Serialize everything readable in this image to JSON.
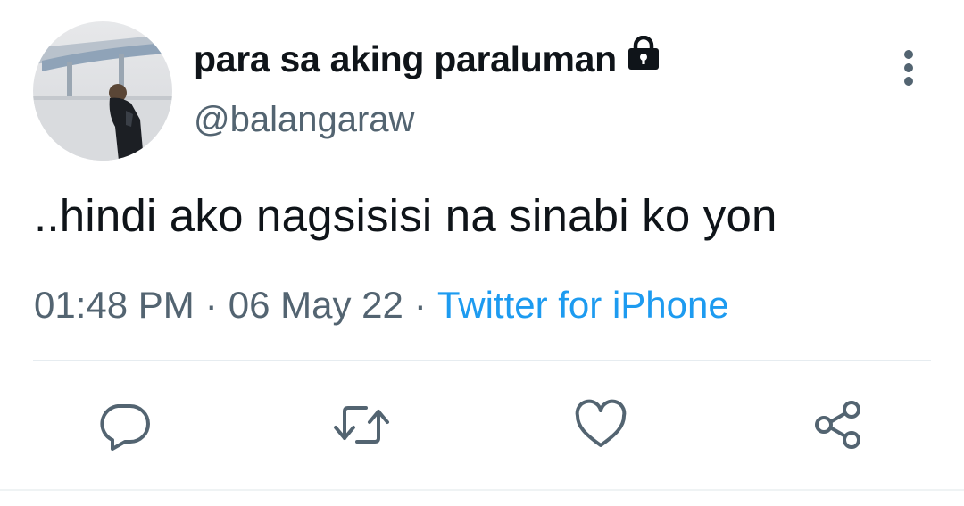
{
  "tweet": {
    "display_name": "para sa aking paraluman",
    "protected_icon": "lock-icon",
    "handle": "@balangaraw",
    "text": "..hindi ako nagsisisi na sinabi ko yon",
    "time": "01:48 PM",
    "separator": "·",
    "date": "06 May 22",
    "source": "Twitter for iPhone"
  },
  "actions": {
    "reply_icon": "reply-bubble-icon",
    "retweet_icon": "retweet-icon",
    "like_icon": "heart-icon",
    "share_icon": "share-icon",
    "more_icon": "more-vertical-icon"
  },
  "colors": {
    "text_primary": "#0f1419",
    "text_secondary": "#536471",
    "link": "#1d9bf0",
    "icon": "#536471",
    "divider": "#e6ecf0"
  }
}
